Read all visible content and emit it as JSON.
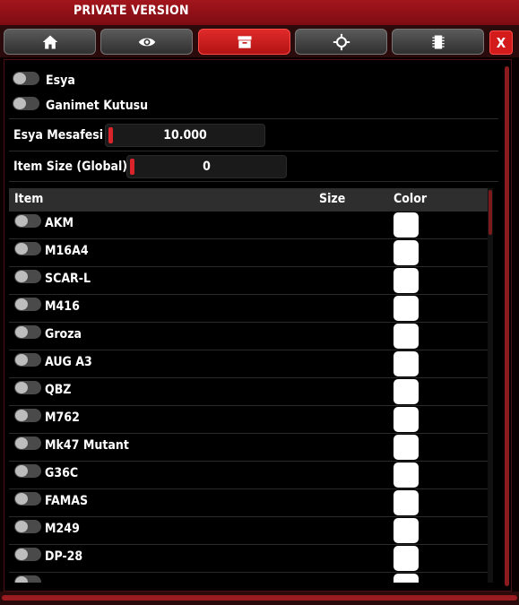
{
  "window": {
    "title": "PRIVATE VERSION",
    "close_label": "X"
  },
  "tabs": [
    {
      "icon": "home-icon",
      "active": false
    },
    {
      "icon": "eye-icon",
      "active": false
    },
    {
      "icon": "box-icon",
      "active": true
    },
    {
      "icon": "crosshair-icon",
      "active": false
    },
    {
      "icon": "chip-icon",
      "active": false
    }
  ],
  "settings": {
    "item_toggle_label": "Esya",
    "lootbox_toggle_label": "Ganimet Kutusu",
    "distance_label": "Esya Mesafesi",
    "distance_value": "10.000",
    "size_label": "Item Size (Global)",
    "size_value": "0"
  },
  "table": {
    "headers": {
      "item": "Item",
      "size": "Size",
      "color": "Color"
    },
    "rows": [
      {
        "name": "AKM",
        "color": "#ffffff"
      },
      {
        "name": "M16A4",
        "color": "#ffffff"
      },
      {
        "name": "SCAR-L",
        "color": "#ffffff"
      },
      {
        "name": "M416",
        "color": "#ffffff"
      },
      {
        "name": "Groza",
        "color": "#ffffff"
      },
      {
        "name": "AUG A3",
        "color": "#ffffff"
      },
      {
        "name": "QBZ",
        "color": "#ffffff"
      },
      {
        "name": "M762",
        "color": "#ffffff"
      },
      {
        "name": "Mk47 Mutant",
        "color": "#ffffff"
      },
      {
        "name": "G36C",
        "color": "#ffffff"
      },
      {
        "name": "FAMAS",
        "color": "#ffffff"
      },
      {
        "name": "M249",
        "color": "#ffffff"
      },
      {
        "name": "DP-28",
        "color": "#ffffff"
      },
      {
        "name": "",
        "color": "#ffffff"
      }
    ]
  },
  "colors": {
    "accent": "#d41b1b",
    "titlebar": "#8f1118",
    "panel": "#000000"
  }
}
